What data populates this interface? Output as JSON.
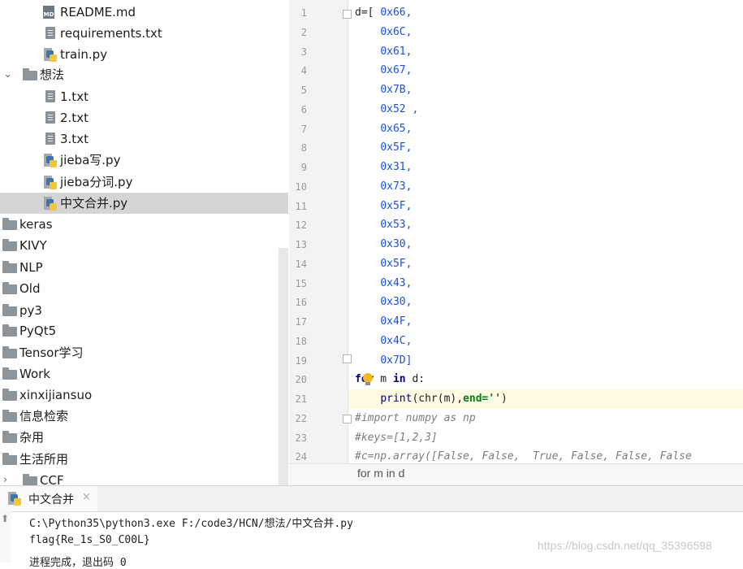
{
  "project_tree": {
    "items": [
      {
        "label": "README.md",
        "icon": "markdown-file-icon"
      },
      {
        "label": "requirements.txt",
        "icon": "text-file-icon"
      },
      {
        "label": "train.py",
        "icon": "python-file-icon"
      },
      {
        "label": "想法",
        "icon": "folder-icon",
        "expanded": true
      },
      {
        "label": "1.txt",
        "icon": "text-file-icon"
      },
      {
        "label": "2.txt",
        "icon": "text-file-icon"
      },
      {
        "label": "3.txt",
        "icon": "text-file-icon"
      },
      {
        "label": "jieba写.py",
        "icon": "python-file-icon"
      },
      {
        "label": "jieba分词.py",
        "icon": "python-file-icon"
      },
      {
        "label": "中文合并.py",
        "icon": "python-file-icon",
        "selected": true
      },
      {
        "label": "keras",
        "icon": "folder-icon"
      },
      {
        "label": "KIVY",
        "icon": "folder-icon"
      },
      {
        "label": "NLP",
        "icon": "folder-icon"
      },
      {
        "label": "Old",
        "icon": "folder-icon"
      },
      {
        "label": "py3",
        "icon": "folder-icon"
      },
      {
        "label": "PyQt5",
        "icon": "folder-icon"
      },
      {
        "label": "Tensor学习",
        "icon": "folder-icon"
      },
      {
        "label": "Work",
        "icon": "folder-icon"
      },
      {
        "label": "xinxijiansuo",
        "icon": "folder-icon"
      },
      {
        "label": "信息检索",
        "icon": "folder-icon"
      },
      {
        "label": "杂用",
        "icon": "folder-icon"
      },
      {
        "label": "生活所用",
        "icon": "folder-icon"
      },
      {
        "label": "CCF",
        "icon": "folder-icon",
        "collapsed": true
      }
    ]
  },
  "editor": {
    "line_numbers": [
      "1",
      "2",
      "3",
      "4",
      "5",
      "6",
      "7",
      "8",
      "9",
      "10",
      "11",
      "12",
      "13",
      "14",
      "15",
      "16",
      "17",
      "18",
      "19",
      "20",
      "21",
      "22",
      "23",
      "24"
    ],
    "first_line_prefix": "d=[ ",
    "hex_values": [
      "0x66,",
      "0x6C,",
      "0x61,",
      "0x67,",
      "0x7B,",
      "0x52 ,",
      "0x65,",
      "0x5F,",
      "0x31,",
      "0x73,",
      "0x5F,",
      "0x53,",
      "0x30,",
      "0x5F,",
      "0x43,",
      "0x30,",
      "0x4F,",
      "0x4C,",
      "0x7D]"
    ],
    "line20": {
      "kw1": "for",
      "mid": " m ",
      "kw2": "in",
      "end": " d:"
    },
    "line21": {
      "fn": "print",
      "args": "(chr(m),",
      "param": "end=",
      "str": "''",
      "close": ")"
    },
    "line22": "#import numpy as np",
    "line23": "#keys=[1,2,3]",
    "line24": "#c=np.array([False, False,  True, False, False, False"
  },
  "breadcrumb": "for m in d",
  "run_panel": {
    "tab_label": "中文合并",
    "close_glyph": "×",
    "up_glyph": "⬆",
    "output": [
      "C:\\Python35\\python3.exe F:/code3/HCN/想法/中文合并.py",
      "flag{Re_1s_S0_C00L}",
      "进程完成，退出码 0"
    ]
  },
  "watermark": "https://blog.csdn.net/qq_35396598",
  "colors": {
    "selection": "#d5d5d5",
    "current_line": "#fffae3",
    "number": "#1750eb",
    "keyword": "#000080",
    "string": "#067d17"
  }
}
